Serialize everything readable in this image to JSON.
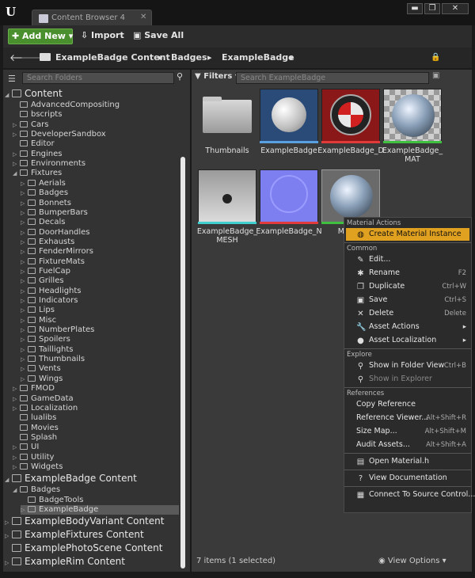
{
  "tab": {
    "label": "Content Browser 4"
  },
  "window": {
    "minimize": "▬",
    "maximize": "❐",
    "close": "✕"
  },
  "toolbar": {
    "add_new": "Add New",
    "import": "Import",
    "save_all": "Save All"
  },
  "breadcrumb": {
    "items": [
      "ExampleBadge Content",
      "Badges",
      "ExampleBadge"
    ]
  },
  "left": {
    "search_placeholder": "Search Folders",
    "tree": [
      {
        "label": "Content",
        "level": 0,
        "big": true,
        "expanded": true
      },
      {
        "label": "AdvancedCompositing",
        "level": 1
      },
      {
        "label": "bscripts",
        "level": 1
      },
      {
        "label": "Cars",
        "level": 1,
        "arrow": true
      },
      {
        "label": "DeveloperSandbox",
        "level": 1,
        "arrow": true
      },
      {
        "label": "Editor",
        "level": 1
      },
      {
        "label": "Engines",
        "level": 1,
        "arrow": true
      },
      {
        "label": "Environments",
        "level": 1,
        "arrow": true
      },
      {
        "label": "Fixtures",
        "level": 1,
        "expanded": true
      },
      {
        "label": "Aerials",
        "level": 2,
        "arrow": true
      },
      {
        "label": "Badges",
        "level": 2,
        "arrow": true
      },
      {
        "label": "Bonnets",
        "level": 2,
        "arrow": true
      },
      {
        "label": "BumperBars",
        "level": 2,
        "arrow": true
      },
      {
        "label": "Decals",
        "level": 2,
        "arrow": true
      },
      {
        "label": "DoorHandles",
        "level": 2,
        "arrow": true
      },
      {
        "label": "Exhausts",
        "level": 2,
        "arrow": true
      },
      {
        "label": "FenderMirrors",
        "level": 2,
        "arrow": true
      },
      {
        "label": "FixtureMats",
        "level": 2,
        "arrow": true
      },
      {
        "label": "FuelCap",
        "level": 2,
        "arrow": true
      },
      {
        "label": "Grilles",
        "level": 2,
        "arrow": true
      },
      {
        "label": "Headlights",
        "level": 2,
        "arrow": true
      },
      {
        "label": "Indicators",
        "level": 2,
        "arrow": true
      },
      {
        "label": "Lips",
        "level": 2,
        "arrow": true
      },
      {
        "label": "Misc",
        "level": 2,
        "arrow": true
      },
      {
        "label": "NumberPlates",
        "level": 2,
        "arrow": true
      },
      {
        "label": "Spoilers",
        "level": 2,
        "arrow": true
      },
      {
        "label": "Taillights",
        "level": 2,
        "arrow": true
      },
      {
        "label": "Thumbnails",
        "level": 2,
        "arrow": true
      },
      {
        "label": "Vents",
        "level": 2,
        "arrow": true
      },
      {
        "label": "Wings",
        "level": 2,
        "arrow": true
      },
      {
        "label": "FMOD",
        "level": 1,
        "arrow": true
      },
      {
        "label": "GameData",
        "level": 1,
        "arrow": true
      },
      {
        "label": "Localization",
        "level": 1,
        "arrow": true
      },
      {
        "label": "lualibs",
        "level": 1
      },
      {
        "label": "Movies",
        "level": 1
      },
      {
        "label": "Splash",
        "level": 1
      },
      {
        "label": "UI",
        "level": 1,
        "arrow": true
      },
      {
        "label": "Utility",
        "level": 1,
        "arrow": true
      },
      {
        "label": "Widgets",
        "level": 1,
        "arrow": true
      },
      {
        "label": "ExampleBadge Content",
        "level": 0,
        "big": true,
        "expanded": true
      },
      {
        "label": "Badges",
        "level": 1,
        "expanded": true
      },
      {
        "label": "BadgeTools",
        "level": 2
      },
      {
        "label": "ExampleBadge",
        "level": 2,
        "arrow": true,
        "selected": true
      },
      {
        "label": "ExampleBodyVariant Content",
        "level": 0,
        "big": true,
        "arrow": true
      },
      {
        "label": "ExampleFixtures Content",
        "level": 0,
        "big": true,
        "arrow": true
      },
      {
        "label": "ExamplePhotoScene Content",
        "level": 0,
        "big": true
      },
      {
        "label": "ExampleRim Content",
        "level": 0,
        "big": true,
        "arrow": true
      }
    ]
  },
  "right": {
    "filters": "Filters",
    "search_placeholder": "Search ExampleBadge",
    "assets": [
      {
        "label": "Thumbnails",
        "kind": "folder"
      },
      {
        "label": "ExampleBadge",
        "kind": "mesh-sphere",
        "bar": "#5aa0e0"
      },
      {
        "label": "ExampleBadge_D",
        "kind": "texture-d",
        "bar": "#e03a3a"
      },
      {
        "label": "ExampleBadge_\nMAT",
        "kind": "material",
        "bar": "#40c040"
      },
      {
        "label": "ExampleBadge_\nMESH",
        "kind": "static-mesh",
        "bar": "#40d0d0"
      },
      {
        "label": "ExampleBadge_N",
        "kind": "normal-map",
        "bar": "#e03a3a"
      },
      {
        "label": "MASTE\nBad",
        "kind": "master-material",
        "bar": "#40c040"
      }
    ],
    "status": "7 items (1 selected)",
    "view_options": "View Options"
  },
  "context_menu": {
    "sections": [
      {
        "header": "Material Actions",
        "items": [
          {
            "label": "Create Material Instance",
            "icon": "material-instance-icon",
            "glyph": "◍",
            "highlight": true
          }
        ]
      },
      {
        "header": "Common",
        "items": [
          {
            "label": "Edit...",
            "icon": "edit-icon",
            "glyph": "✎"
          },
          {
            "label": "Rename",
            "icon": "rename-icon",
            "glyph": "✱",
            "shortcut": "F2"
          },
          {
            "label": "Duplicate",
            "icon": "duplicate-icon",
            "glyph": "❐",
            "shortcut": "Ctrl+W"
          },
          {
            "label": "Save",
            "icon": "save-icon",
            "glyph": "▣",
            "shortcut": "Ctrl+S"
          },
          {
            "label": "Delete",
            "icon": "delete-icon",
            "glyph": "✕",
            "shortcut": "Delete"
          },
          {
            "label": "Asset Actions",
            "icon": "wrench-icon",
            "glyph": "🔧",
            "submenu": true
          },
          {
            "label": "Asset Localization",
            "icon": "globe-icon",
            "glyph": "●",
            "submenu": true
          }
        ]
      },
      {
        "header": "Explore",
        "items": [
          {
            "label": "Show in Folder View",
            "icon": "search-icon",
            "glyph": "⚲",
            "shortcut": "Ctrl+B"
          },
          {
            "label": "Show in Explorer",
            "icon": "search-icon",
            "glyph": "⚲",
            "disabled": true
          }
        ]
      },
      {
        "header": "References",
        "items": [
          {
            "label": "Copy Reference",
            "noicon": true
          },
          {
            "label": "Reference Viewer...",
            "noicon": true,
            "shortcut": "Alt+Shift+R"
          },
          {
            "label": "Size Map...",
            "noicon": true,
            "shortcut": "Alt+Shift+M"
          },
          {
            "label": "Audit Assets...",
            "noicon": true,
            "shortcut": "Alt+Shift+A"
          }
        ]
      },
      {
        "header": "",
        "items": [
          {
            "label": "Open Material.h",
            "icon": "code-file-icon",
            "glyph": "▤"
          }
        ]
      },
      {
        "header": "",
        "items": [
          {
            "label": "View Documentation",
            "icon": "help-icon",
            "glyph": "?"
          }
        ]
      },
      {
        "header": "",
        "items": [
          {
            "label": "Connect To Source Control...",
            "icon": "source-control-icon",
            "glyph": "▦"
          }
        ]
      }
    ]
  }
}
